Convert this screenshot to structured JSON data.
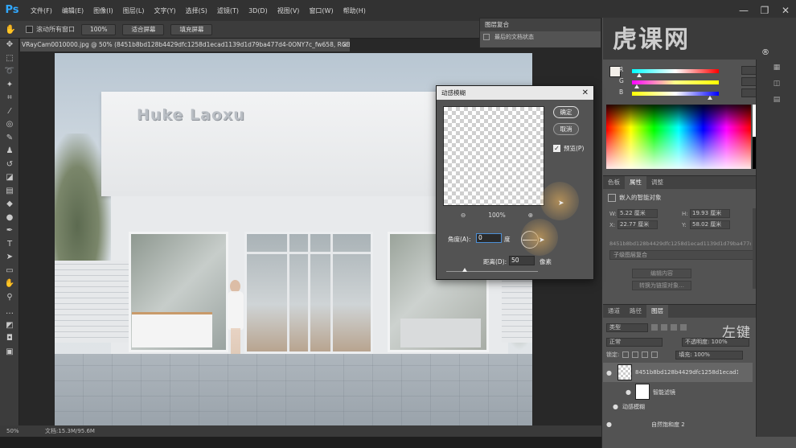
{
  "app": {
    "logo": "Ps"
  },
  "menu": [
    "文件(F)",
    "编辑(E)",
    "图像(I)",
    "图层(L)",
    "文字(Y)",
    "选择(S)",
    "滤镜(T)",
    "3D(D)",
    "视图(V)",
    "窗口(W)",
    "帮助(H)"
  ],
  "window_controls": {
    "minimize": "—",
    "restore": "❐",
    "close": "✕"
  },
  "options_bar": {
    "scroll_all_label": "滚动所有窗口",
    "zoom_value": "100%",
    "fit_screen": "适合屏幕",
    "fill_screen": "填充屏幕"
  },
  "document": {
    "tab_title": "VRayCam0010000.jpg @ 50% (8451b8bd128b4429dfc1258d1ecad1139d1d79ba477d4-0ONY7c_fw658, RGB/8#) *",
    "tab_close": "×",
    "sign_text": "Huke Laoxu"
  },
  "status": {
    "zoom": "50%",
    "doc_info": "文档:15.3M/95.6M"
  },
  "layer_comps": {
    "tab": "图层复合",
    "row": "最后的文档状态"
  },
  "dialog": {
    "title": "动感模糊",
    "close": "✕",
    "ok": "确定",
    "cancel": "取消",
    "preview_label": "预览(P)",
    "preview_check": "✓",
    "zoom_out": "⊖",
    "zoom_pct": "100%",
    "zoom_in": "⊕",
    "angle_label": "角度(A):",
    "angle_value": "0",
    "angle_unit": "度",
    "distance_label": "距离(D):",
    "distance_value": "50",
    "distance_unit": "像素",
    "distance_slider_fraction": 0.2
  },
  "watermark": {
    "text": "虎课网",
    "sub": "®"
  },
  "color_panel": {
    "sliders": [
      {
        "label": "R",
        "value": "",
        "fraction": 0.08,
        "gradient": "linear-gradient(90deg, #0ff, #fff 50%, #f00)"
      },
      {
        "label": "G",
        "value": "",
        "fraction": 0.06,
        "gradient": "linear-gradient(90deg, #f0f, #ff8 50%, #ff0)"
      },
      {
        "label": "B",
        "value": "",
        "fraction": 0.9,
        "gradient": "linear-gradient(90deg, #ff0, #fff 50%, #00f)"
      }
    ],
    "fg_color": "#f3efe9"
  },
  "properties": {
    "tabs": [
      "色板",
      "属性",
      "调整"
    ],
    "active_tab": 1,
    "header": "嵌入的智能对象",
    "w_label": "W:",
    "w_value": "5.22 厘米",
    "h_label": "H:",
    "h_value": "19.93 厘米",
    "x_label": "X:",
    "x_value": "22.77 厘米",
    "y_label": "Y:",
    "y_value": "58.02 厘米",
    "link_name": "8451b8bd128b4429dfc1258d1ecad1139d1d79ba477d4…",
    "embed_btn": "子级图层复合",
    "edit_btn": "编辑内容",
    "convert_btn": "转换为链接对象…"
  },
  "layers": {
    "tabs": [
      "通道",
      "路径",
      "图层"
    ],
    "active_tab": 2,
    "kind_filter": "类型",
    "blend_mode": "正常",
    "opacity": "不透明度: 100%",
    "lock_label": "锁定:",
    "fill": "填充: 100%",
    "rows": [
      {
        "name": "8451b8bd128b4429dfc1258d1ecad11…",
        "eye": "●",
        "selected": true
      },
      {
        "name": "智能滤镜",
        "eye": "●",
        "selected": false
      },
      {
        "name": "动感模糊",
        "eye": "●",
        "selected": false
      },
      {
        "name": "自然饱和度 2",
        "eye": "●",
        "selected": false
      }
    ]
  },
  "overlay_text": "左键"
}
